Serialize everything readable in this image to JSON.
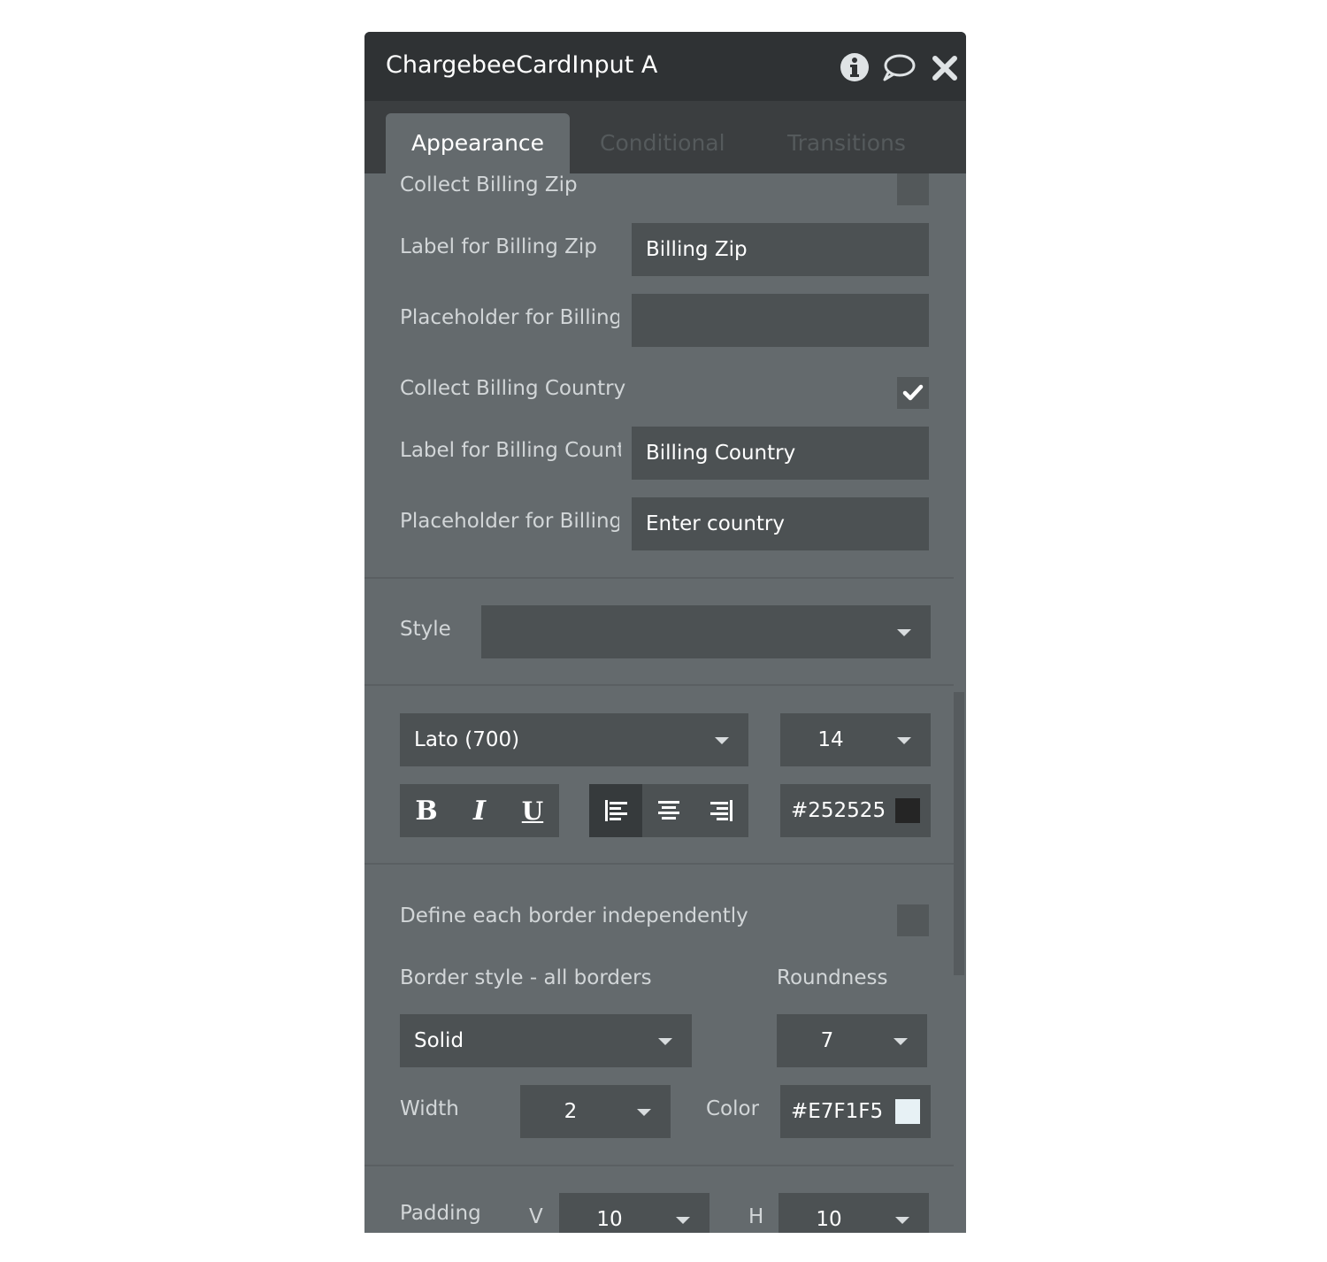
{
  "window": {
    "title": "ChargebeeCardInput A"
  },
  "tabs": [
    {
      "label": "Appearance"
    },
    {
      "label": "Conditional"
    },
    {
      "label": "Transitions"
    }
  ],
  "billing": {
    "collect_zip_label": "Collect Billing Zip",
    "collect_zip_checked": false,
    "label_zip_label": "Label for Billing Zip",
    "label_zip_value": "Billing Zip",
    "placeholder_zip_label": "Placeholder for Billing",
    "placeholder_zip_value": "",
    "collect_country_label": "Collect Billing Country",
    "collect_country_checked": true,
    "label_country_label": "Label for Billing Count",
    "label_country_value": "Billing Country",
    "placeholder_country_label": "Placeholder for Billing",
    "placeholder_country_value": "Enter country"
  },
  "style": {
    "label": "Style",
    "value": ""
  },
  "font": {
    "family": "Lato (700)",
    "size": "14",
    "bold": "B",
    "italic": "I",
    "underline": "U",
    "align_active": "left",
    "color_hex": "#252525",
    "color_swatch": "#252525"
  },
  "border": {
    "independent_label": "Define each border independently",
    "independent_checked": false,
    "style_label": "Border style - all borders",
    "roundness_label": "Roundness",
    "style_value": "Solid",
    "roundness_value": "7",
    "width_label": "Width",
    "width_value": "2",
    "color_label": "Color",
    "color_hex": "#E7F1F5",
    "color_swatch": "#E7F1F5"
  },
  "padding": {
    "label": "Padding",
    "v_label": "V",
    "v_value": "10",
    "h_label": "H",
    "h_value": "10"
  }
}
